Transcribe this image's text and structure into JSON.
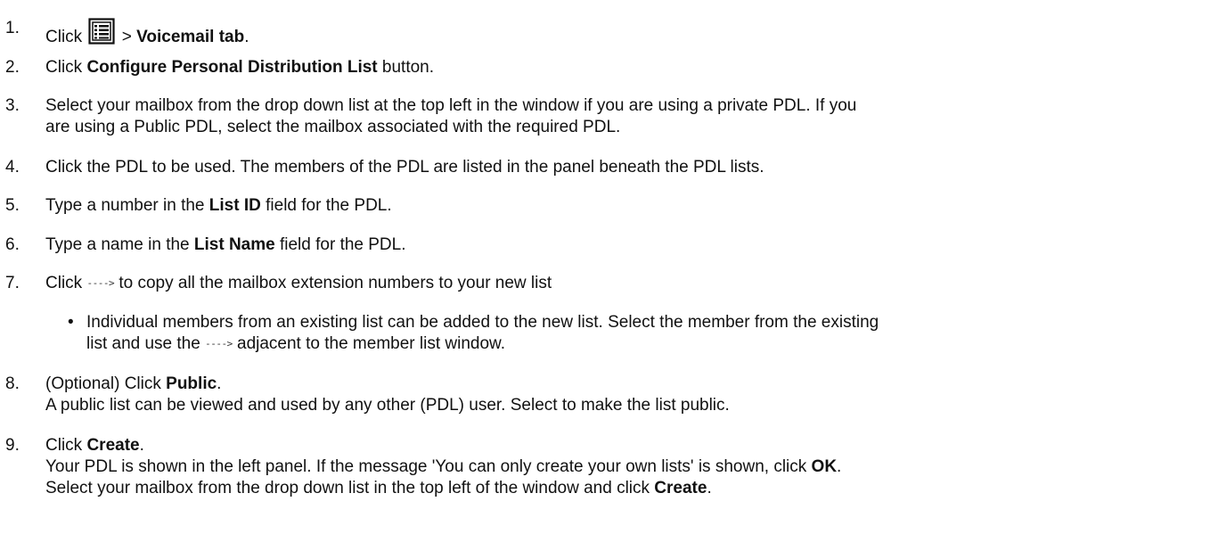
{
  "steps": [
    {
      "num": "1.",
      "t1": "Click ",
      "icon": "list-menu-icon",
      "t2": " > ",
      "b1": "Voicemail tab",
      "t3": "."
    },
    {
      "num": "2.",
      "t1": "Click ",
      "b1": "Configure Personal Distribution List",
      "t2": " button."
    },
    {
      "num": "3.",
      "line1": "Select your mailbox from the drop down list at the top left in the window if you are using a private PDL. If you",
      "line2": "are using a Public PDL, select the mailbox associated with the required PDL."
    },
    {
      "num": "4.",
      "text": "Click the PDL to be used. The members of the PDL are listed in the panel beneath the PDL lists."
    },
    {
      "num": "5.",
      "t1": "Type a number in the ",
      "b1": "List ID",
      "t2": " field for the PDL."
    },
    {
      "num": "6.",
      "t1": "Type a name in the ",
      "b1": "List Name",
      "t2": " field for the PDL."
    },
    {
      "num": "7.",
      "t1": "Click ",
      "arrow": "---->",
      "t2": " to copy all the mailbox extension numbers to your new list"
    },
    {
      "num": "8.",
      "t1": "(Optional) Click ",
      "b1": "Public",
      "t2": ".",
      "line2": "A public list can be viewed and used by any other (PDL) user. Select to make the list public."
    },
    {
      "num": "9.",
      "t1": "Click ",
      "b1": "Create",
      "t2": ".",
      "l2a": "Your PDL is shown in the left panel. If the message 'You can only create your own lists' is shown, click ",
      "l2b": "OK",
      "l2c": ".",
      "l3a": "Select your mailbox from the drop down list in the top left of the window and click ",
      "l3b": "Create",
      "l3c": "."
    }
  ],
  "bullet": {
    "symbol": "•",
    "line1": "Individual members from an existing list can be added to the new list. Select the member from the existing",
    "l2a": "list and use the ",
    "arrow": "---->",
    "l2b": " adjacent to the member list window."
  }
}
